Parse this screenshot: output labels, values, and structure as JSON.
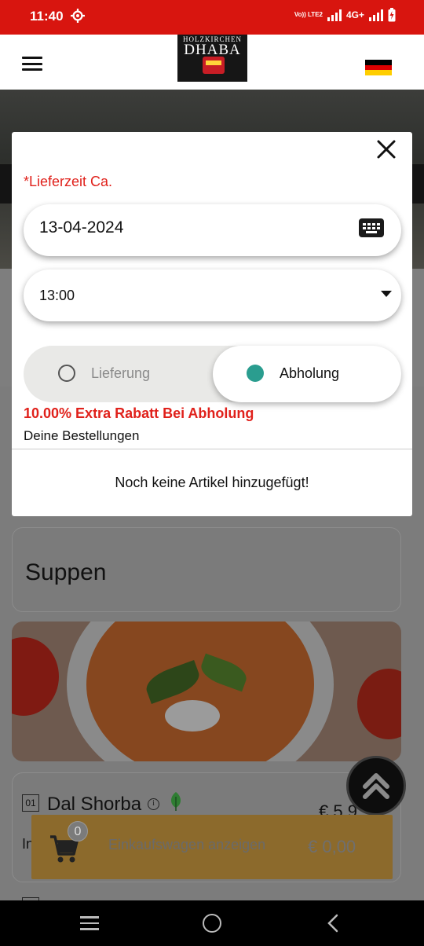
{
  "status_bar": {
    "time": "11:40",
    "volte": "Vo)) LTE2",
    "network": "4G+",
    "icons": [
      "settings-gear-icon",
      "signal-icon",
      "battery-charging-icon"
    ]
  },
  "header": {
    "logo_top": "HOLZKIRCHEN",
    "logo_main": "DHABA",
    "language_flag": "de",
    "flag_colors": [
      "#000000",
      "#dd0000",
      "#ffce00"
    ]
  },
  "modal": {
    "delivery_time_label": "*Lieferzeit Ca.",
    "date_value": "13-04-2024",
    "time_value": "13:00",
    "option_delivery": "Lieferung",
    "option_pickup": "Abholung",
    "selected_option": "Abholung",
    "discount_text": "10.00% Extra Rabatt Bei Abholung",
    "orders_title": "Deine Bestellungen",
    "empty_message": "Noch keine Artikel hinzugefügt!"
  },
  "menu": {
    "category_title": "Suppen",
    "dish": {
      "number": "01",
      "name": "Dal Shorba",
      "price": "€ 5,9",
      "description_start": "In"
    }
  },
  "cart": {
    "count": "0",
    "label": "Einkaufswagen anzeigen",
    "total": "€ 0,00"
  },
  "colors": {
    "status_bar": "#d8150f",
    "accent_red": "#e0211b",
    "radio_selected": "#2a9d8f",
    "cart_bar": "#8c6a2c"
  }
}
